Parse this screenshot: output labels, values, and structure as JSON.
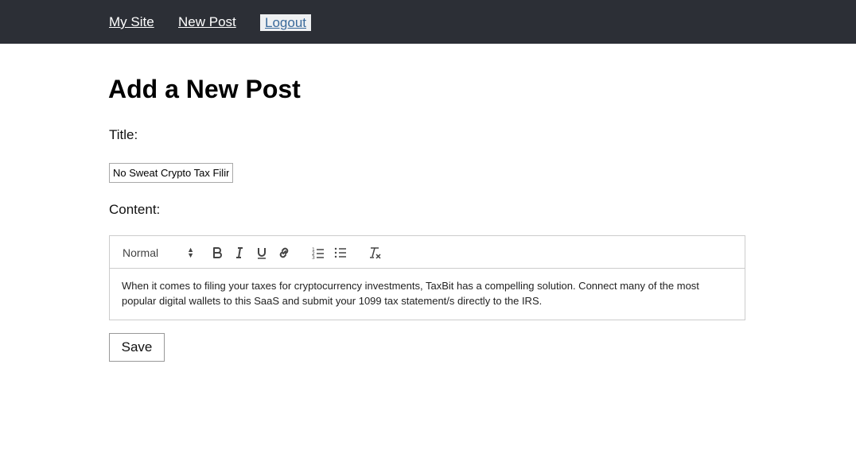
{
  "nav": {
    "site_label": "My Site",
    "new_post_label": "New Post",
    "logout_label": "Logout"
  },
  "page": {
    "heading": "Add a New Post"
  },
  "form": {
    "title_label": "Title:",
    "title_value": "No Sweat Crypto Tax Filing",
    "content_label": "Content:",
    "save_label": "Save"
  },
  "editor": {
    "header_format": "Normal",
    "toolbar_icons": [
      "chevron-updown-icon",
      "bold-icon",
      "italic-icon",
      "underline-icon",
      "link-icon",
      "ordered-list-icon",
      "bullet-list-icon",
      "clear-format-icon"
    ],
    "body_text": "When it comes to filing your taxes for cryptocurrency investments, TaxBit has a compelling solution. Connect many of the most popular digital wallets to this SaaS and submit your 1099 tax statement/s directly to the IRS."
  },
  "colors": {
    "navbar_bg": "#2c2f36",
    "nav_link": "#ffffff",
    "logout_bg": "#eef0f2",
    "logout_text": "#3a6a9b"
  }
}
